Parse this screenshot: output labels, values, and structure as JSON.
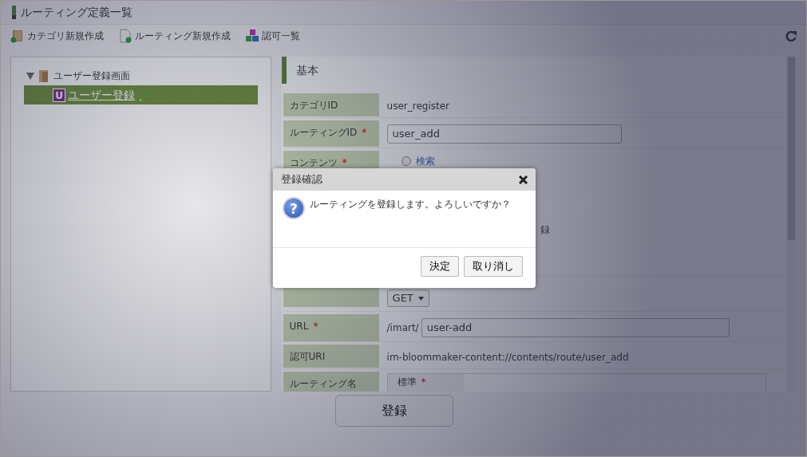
{
  "window": {
    "title": "ルーティング定義一覧"
  },
  "toolbar": [
    {
      "label": "カテゴリ新規作成",
      "kind": "folder"
    },
    {
      "label": "ルーティング新規作成",
      "kind": "page"
    },
    {
      "label": "認可一覧",
      "kind": "blocks"
    }
  ],
  "tree": [
    {
      "label": "ユーザー登録画面",
      "expanded": true,
      "children": [
        {
          "label": "ユーザー登録",
          "badge": "U",
          "selected": true
        }
      ]
    }
  ],
  "section": {
    "title": "基本"
  },
  "form": [
    {
      "kind": "text",
      "label": "カテゴリID",
      "value": "user_register"
    },
    {
      "kind": "input",
      "label": "ルーティングID",
      "mark": "*",
      "value": "user_add"
    },
    {
      "kind": "radios",
      "label": "コンテンツ",
      "mark": "*",
      "options": [
        {
          "label": "検索",
          "selected": false
        },
        {
          "label": "録"
        }
      ]
    },
    {
      "kind": "select",
      "value": "GET"
    },
    {
      "kind": "url",
      "label": "URL",
      "mark": "*",
      "prefix": "/imart/",
      "value": "user-add"
    },
    {
      "kind": "text",
      "label": "認可URI",
      "value": "im-bloommaker-content://contents/route/user_add"
    },
    {
      "kind": "locale",
      "label": "ルーティング名",
      "rows": [
        {
          "label": "標準",
          "mark": "*"
        }
      ]
    }
  ],
  "footer": {
    "button": "登録"
  },
  "dialog": {
    "title": "登録確認",
    "icon": "?",
    "message": "ルーティングを登録します。よろしいですか？",
    "buttons": [
      "決定",
      "取り消し"
    ]
  }
}
